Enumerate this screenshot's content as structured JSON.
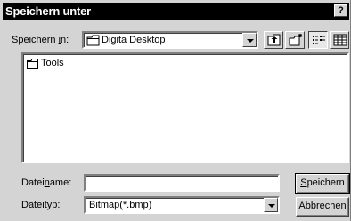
{
  "window": {
    "title": "Speichern unter",
    "help_label": "?"
  },
  "location": {
    "label_pre": "Speichern ",
    "label_accel": "i",
    "label_post": "n:",
    "selected": "Digita Desktop",
    "icon": "desktop-folder-icon"
  },
  "toolbar": {
    "buttons": [
      {
        "name": "up-one-level",
        "icon": "up-folder-icon"
      },
      {
        "name": "new-folder",
        "icon": "new-folder-icon"
      },
      {
        "name": "list-view",
        "icon": "list-view-icon"
      },
      {
        "name": "details-view",
        "icon": "details-view-icon"
      }
    ]
  },
  "files": [
    {
      "name": "Tools",
      "icon": "folder-icon"
    }
  ],
  "filename": {
    "label_pre": "Datei",
    "label_accel": "n",
    "label_post": "ame:",
    "value": ""
  },
  "filetype": {
    "label_pre": "Datei",
    "label_accel": "t",
    "label_post": "yp:",
    "selected": "Bitmap(*.bmp)"
  },
  "buttons": {
    "save_accel": "S",
    "save_rest": "peichern",
    "cancel": "Abbrechen"
  },
  "colors": {
    "dialog_bg": "#d4d4d4",
    "titlebar_bg": "#000000",
    "field_bg": "#ffffff"
  }
}
